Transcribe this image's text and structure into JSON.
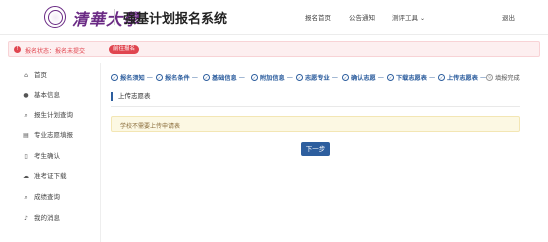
{
  "header": {
    "university_name": "清華大學",
    "system_title": "强基计划报名系统",
    "nav": [
      "报名首页",
      "公告通知",
      "测评工具"
    ],
    "logout_label": "退出"
  },
  "alert": {
    "status_text": "报名状态：报名未提交",
    "action_label": "前往报名"
  },
  "sidebar": {
    "items": [
      {
        "label": "首页",
        "icon": "home-icon"
      },
      {
        "label": "基本信息",
        "icon": "user-icon"
      },
      {
        "label": "报生计划查询",
        "icon": "search-icon"
      },
      {
        "label": "专业志愿填报",
        "icon": "form-icon"
      },
      {
        "label": "考生确认",
        "icon": "file-icon"
      },
      {
        "label": "准考证下载",
        "icon": "cloud-download-icon"
      },
      {
        "label": "成绩查询",
        "icon": "search-icon"
      },
      {
        "label": "我的消息",
        "icon": "bell-icon"
      }
    ]
  },
  "steps": [
    {
      "label": "报名须知",
      "done": true
    },
    {
      "label": "报名条件",
      "done": true
    },
    {
      "label": "基础信息",
      "done": true
    },
    {
      "label": "附加信息",
      "done": true
    },
    {
      "label": "志愿专业",
      "done": true
    },
    {
      "label": "确认志愿",
      "done": true
    },
    {
      "label": "下载志愿表",
      "done": true
    },
    {
      "label": "上传志愿表",
      "done": true
    },
    {
      "label": "填报完成",
      "done": false
    }
  ],
  "main": {
    "section_title": "上传志愿表",
    "notice_text": "学校不需要上传申请表",
    "next_label": "下一步"
  },
  "colors": {
    "accent": "#2d5e9e",
    "alert": "#e0454f",
    "brand_purple": "#6a2a84"
  }
}
